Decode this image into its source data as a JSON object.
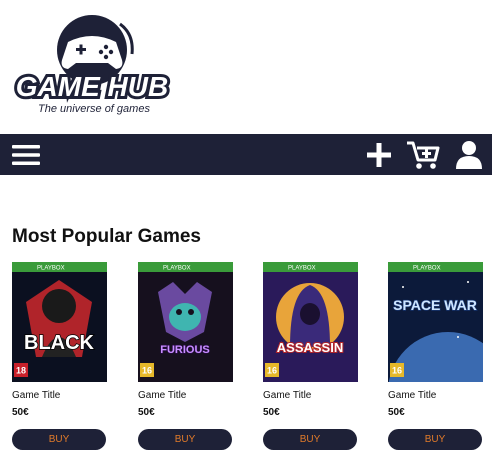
{
  "brand": {
    "name": "GAME HUB",
    "tagline": "The universe of games"
  },
  "navbar": {
    "icons": [
      "menu-icon",
      "add-icon",
      "cart-add-icon",
      "user-icon"
    ],
    "background": "#1e2137"
  },
  "section": {
    "title": "Most Popular Games"
  },
  "games": [
    {
      "platform": "PLAYBOX",
      "cover_text": "BLACK",
      "age_rating": "18",
      "title": "Game Title",
      "price": "50€",
      "buy_label": "BUY"
    },
    {
      "platform": "PLAYBOX",
      "cover_text": "FURIOUS",
      "age_rating": "16",
      "title": "Game Title",
      "price": "50€",
      "buy_label": "BUY"
    },
    {
      "platform": "PLAYBOX",
      "cover_text": "ASSASSIN",
      "age_rating": "16",
      "title": "Game Title",
      "price": "50€",
      "buy_label": "BUY"
    },
    {
      "platform": "PLAYBOX",
      "cover_text": "SPACE WAR",
      "age_rating": "16",
      "title": "Game Title",
      "price": "50€",
      "buy_label": "BUY"
    }
  ],
  "colors": {
    "accent": "#e07a2a",
    "dark": "#1e2137",
    "platform_bar": "#3a9b3a"
  }
}
